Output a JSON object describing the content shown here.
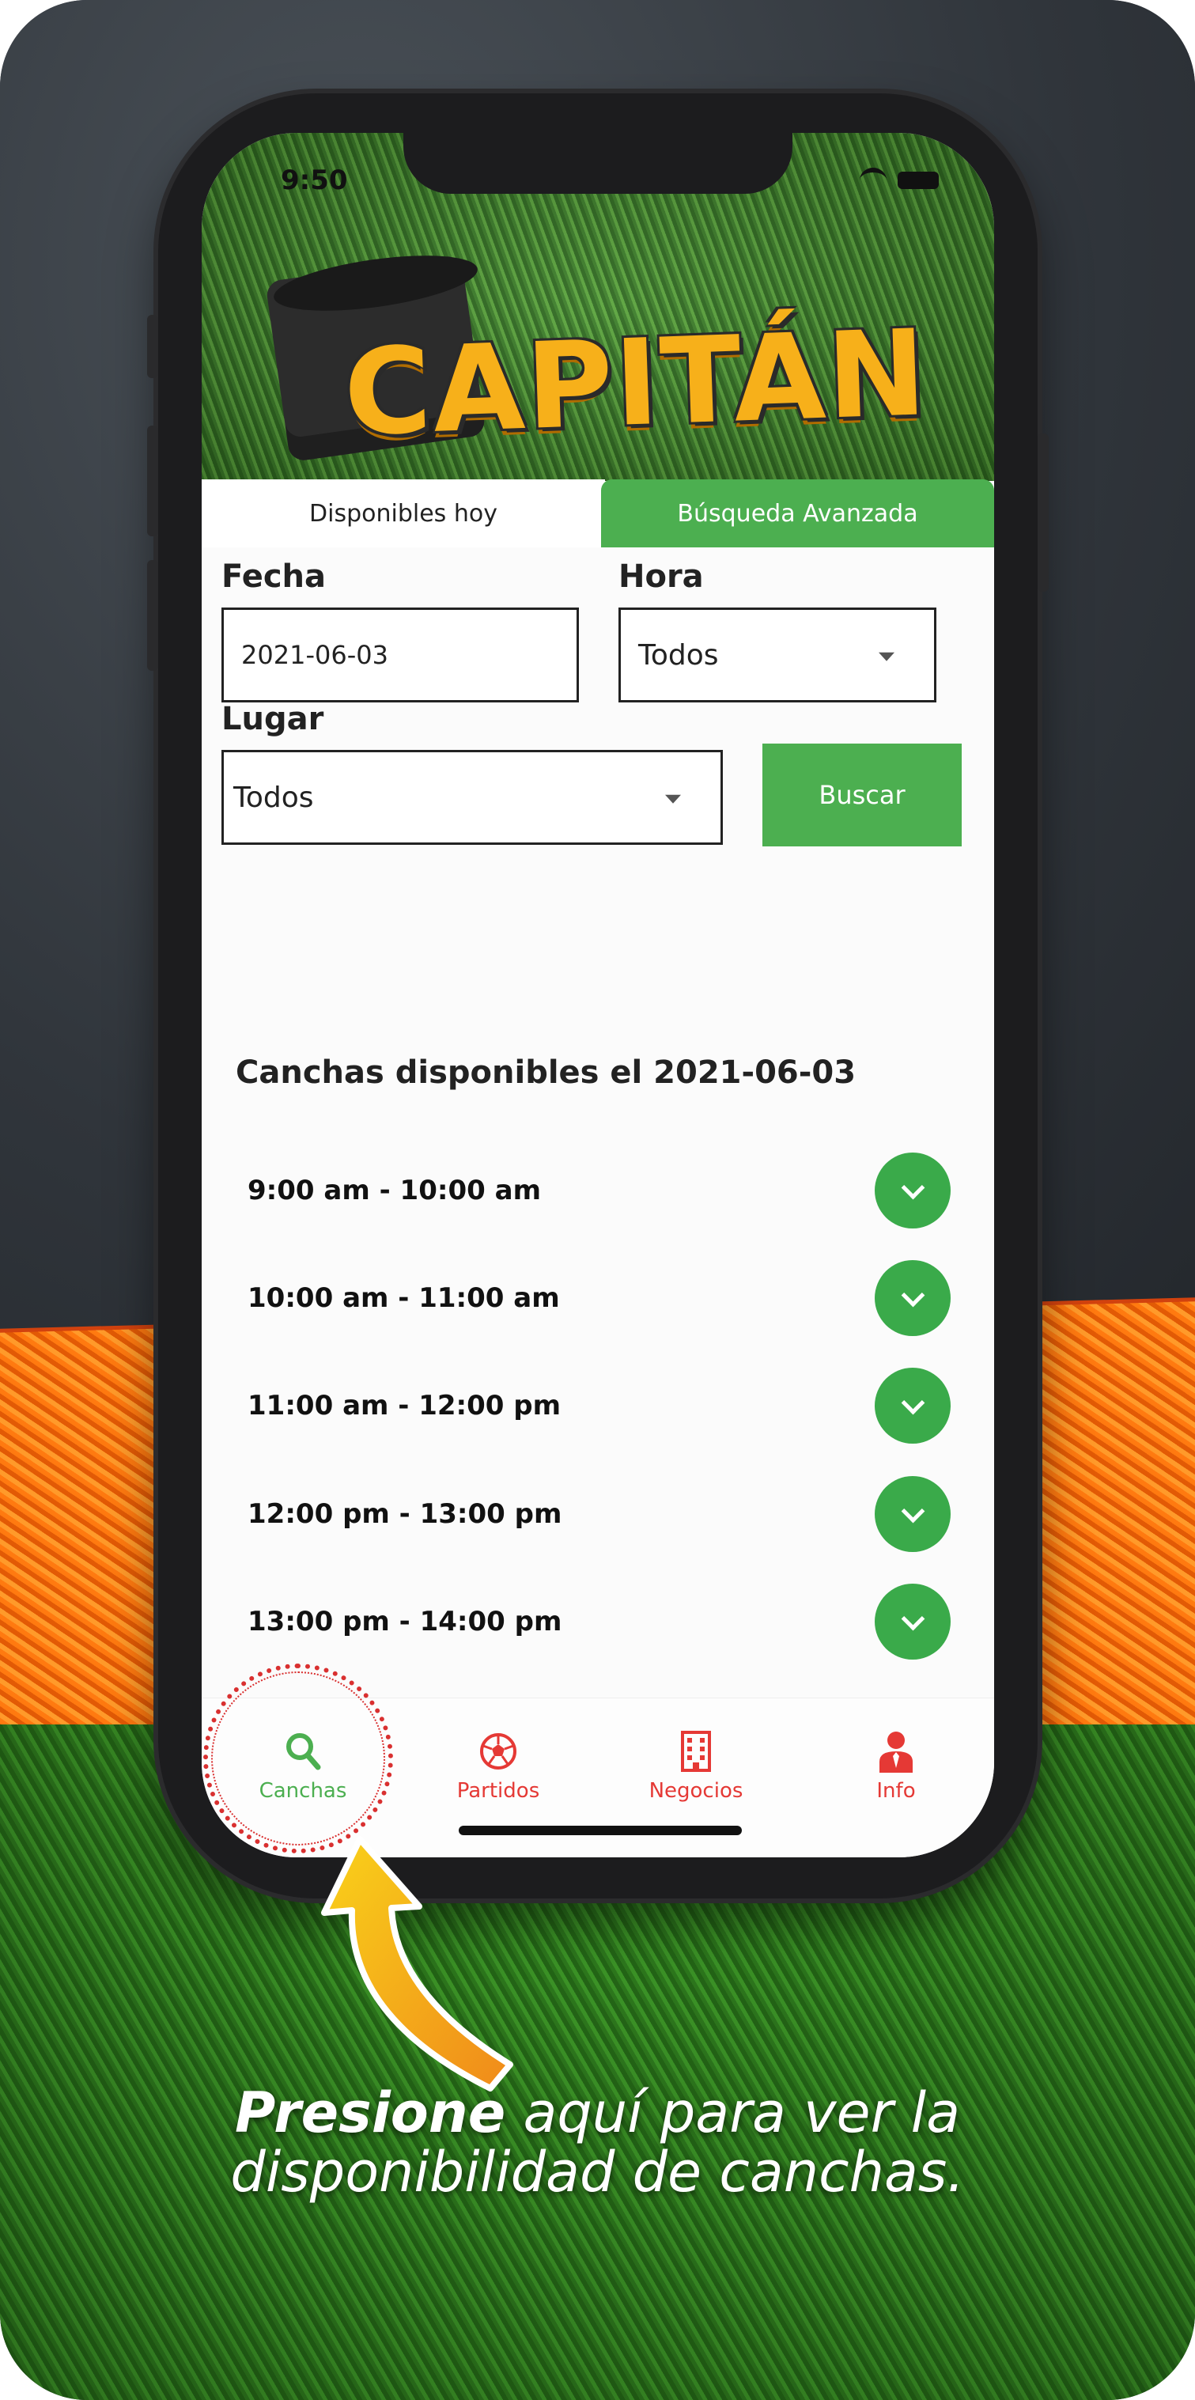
{
  "status": {
    "time": "9:50"
  },
  "brand": {
    "logo_text": "CAPITÁN"
  },
  "tabs": [
    {
      "label": "Disponibles hoy",
      "active": false
    },
    {
      "label": "Búsqueda Avanzada",
      "active": true
    }
  ],
  "form": {
    "fecha": {
      "label": "Fecha",
      "value": "2021-06-03"
    },
    "hora": {
      "label": "Hora",
      "value": "Todos"
    },
    "lugar": {
      "label": "Lugar",
      "value": "Todos"
    },
    "search_button": "Buscar"
  },
  "availability": {
    "title": "Canchas disponibles el 2021-06-03",
    "slots": [
      "9:00 am -  10:00 am",
      "10:00 am -  11:00 am",
      "11:00 am -  12:00 pm",
      "12:00 pm -  13:00 pm",
      "13:00 pm -  14:00 pm"
    ]
  },
  "nav": {
    "items": [
      {
        "label": "Canchas",
        "icon": "search-icon",
        "color": "#4caf50",
        "active": true
      },
      {
        "label": "Partidos",
        "icon": "soccer-ball-icon",
        "color": "#e53935",
        "active": false
      },
      {
        "label": "Negocios",
        "icon": "building-icon",
        "color": "#e53935",
        "active": false
      },
      {
        "label": "Info",
        "icon": "person-icon",
        "color": "#e53935",
        "active": false
      }
    ]
  },
  "caption": {
    "emphasis": "Presione",
    "line1_rest": " aquí para ver la",
    "line2": "disponibilidad de canchas."
  },
  "colors": {
    "accent": "#4caf50",
    "nav_inactive": "#e53935",
    "highlight": "#d93030",
    "arrow": "#f7b01a"
  }
}
